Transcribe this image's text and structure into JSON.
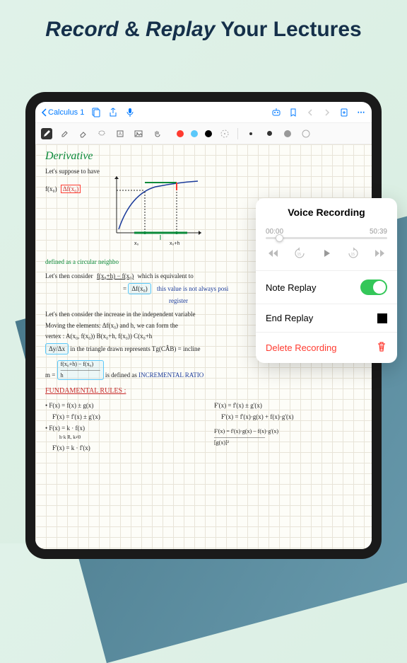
{
  "hero": {
    "word1": "Record",
    "amp": "&",
    "word2": "Replay",
    "rest": "Your Lectures"
  },
  "toolbar": {
    "back_label": "Calculus 1"
  },
  "canvas": {
    "title": "Derivative",
    "line1": "Let's suppose to have",
    "line2a": "f(x₀)",
    "line2b": "Δf(x₀)",
    "graph_labels": {
      "x0": "x₀",
      "x0h": "x₀+h"
    },
    "green_note": "defined as a circular neighbo",
    "line3": "Let's then consider",
    "frac1": "f(x₀+h) − f(x₀)",
    "line3b": "which is equivalent to",
    "eq_box": "Δf(x₀)",
    "blue_note": "this value is not always posi",
    "blue_note2": "register",
    "line4": "Let's then consider the increase in the independent variable",
    "line5": "Moving the elements: Δf(x₀) and h, we can form the",
    "line6": "vertex : A(x₀, f(x₀))   B(x₀+h, f(x₀))   C(x₀+h",
    "line7a": "Δy/Δx",
    "line7b": "in the triangle drawn represents Tg(CÂB) = incline",
    "line8a": "m =",
    "line8_frac": "f(x₀+h) − f(x₀)\n———————\nh",
    "line8b": "is defined as",
    "line8c": "INCREMENTAL RATIO",
    "section": "FUNDAMENTAL RULES :",
    "rule1a": "• F(x) = f(x) ± g(x)",
    "rule1b": "F'(x) = f'(x) ± g'(x)",
    "rule2a": "F'(x) = f'(x) ± g'(x)",
    "rule3a": "• F(x) = k · f(x)",
    "rule3b": "F'(x) = f'(x)·g(x) + f(x)·g'(x)",
    "rule3c": "h·k R, k≠0",
    "rule4a": "F'(x) = k · f'(x)",
    "rule4b": "F'(x) = f'(x)·g(x) − f(x)·g'(x)\n—————————\n[g(x)]²"
  },
  "popup": {
    "title": "Voice Recording",
    "time_start": "00:00",
    "time_end": "50:39",
    "note_replay": "Note Replay",
    "end_replay": "End Replay",
    "delete": "Delete Recording"
  }
}
